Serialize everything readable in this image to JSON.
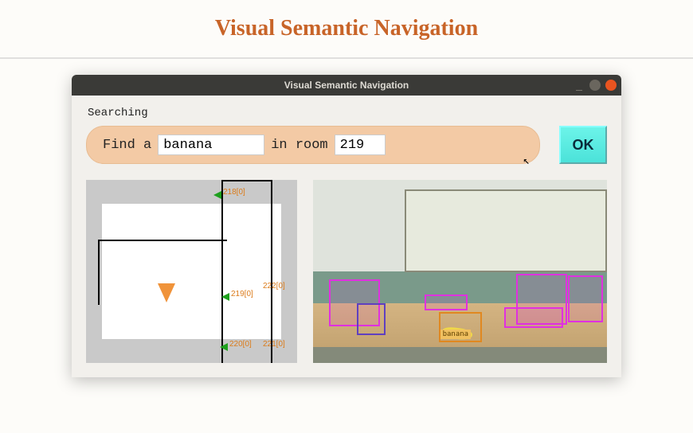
{
  "page": {
    "heading": "Visual Semantic Navigation"
  },
  "window": {
    "title": "Visual Semantic Navigation"
  },
  "status": "Searching",
  "query": {
    "prefix": "Find a",
    "object_value": "banana",
    "middle": "in room",
    "room_value": "219"
  },
  "ok_button": "OK",
  "map": {
    "room_labels": [
      "218[0]",
      "219[0]",
      "222[0]",
      "220[0]",
      "221[0]"
    ]
  },
  "camera": {
    "detection_label": "banana"
  }
}
